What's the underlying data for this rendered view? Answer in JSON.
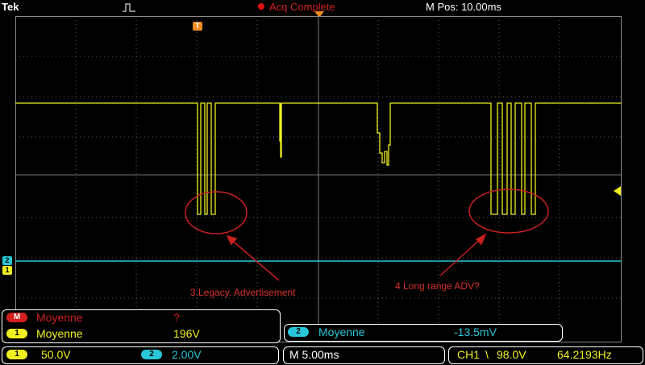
{
  "header": {
    "brand": "Tek",
    "trigger_status": "Acq Complete",
    "m_pos": "M Pos: 10.00ms"
  },
  "markers": {
    "trigger": "T",
    "ch2": "2",
    "ch1": "1"
  },
  "annotations": {
    "legacy": "3.Legacy. Advertisement",
    "long_range": "4 Long range ADV?"
  },
  "measurements": {
    "math": {
      "badge": "M",
      "label": "Moyenne",
      "value": "?"
    },
    "ch1": {
      "badge": "1",
      "label": "Moyenne",
      "value": "196V"
    },
    "ch2": {
      "badge": "2",
      "label": "Moyenne",
      "value": "-13.5mV"
    }
  },
  "bottom": {
    "ch1_badge": "1",
    "ch1_scale": "50.0V",
    "ch2_badge": "2",
    "ch2_scale": "2.00V",
    "timebase": "M 5.00ms",
    "trigger_source": "CH1",
    "trigger_slope": "\\",
    "trigger_level": "98.0V",
    "frequency": "64.2193Hz"
  },
  "colors": {
    "ch1": "#f0f020",
    "ch2": "#27c6d8",
    "math": "#d21f1f",
    "grid": "#6a6a6a",
    "trigger": "#f08a1f"
  },
  "icons": [
    "pulse-icon",
    "status-dot-icon",
    "trigger-marker-icon",
    "trigger-level-arrow-icon"
  ]
}
